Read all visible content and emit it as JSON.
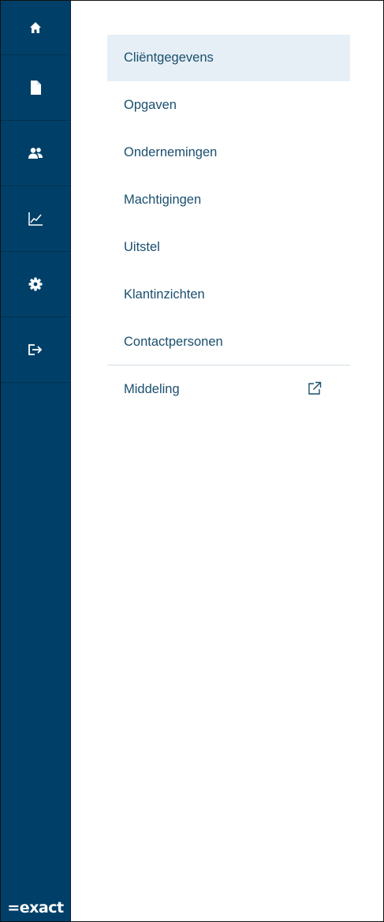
{
  "rail": {
    "items": [
      {
        "icon": "home-icon"
      },
      {
        "icon": "document-icon"
      },
      {
        "icon": "users-icon"
      },
      {
        "icon": "chart-icon"
      },
      {
        "icon": "gear-icon"
      },
      {
        "icon": "logout-icon"
      }
    ],
    "logo": "=exact"
  },
  "menu": {
    "items": [
      {
        "label": "Cliëntgegevens",
        "active": true
      },
      {
        "label": "Opgaven"
      },
      {
        "label": "Ondernemingen"
      },
      {
        "label": "Machtigingen"
      },
      {
        "label": "Uitstel"
      },
      {
        "label": "Klantinzichten"
      },
      {
        "label": "Contactpersonen"
      }
    ],
    "external": {
      "label": "Middeling",
      "icon": "external-link-icon"
    }
  },
  "colors": {
    "rail_bg": "#004068",
    "menu_text": "#1a4f6e",
    "active_bg": "#e6eff5"
  }
}
